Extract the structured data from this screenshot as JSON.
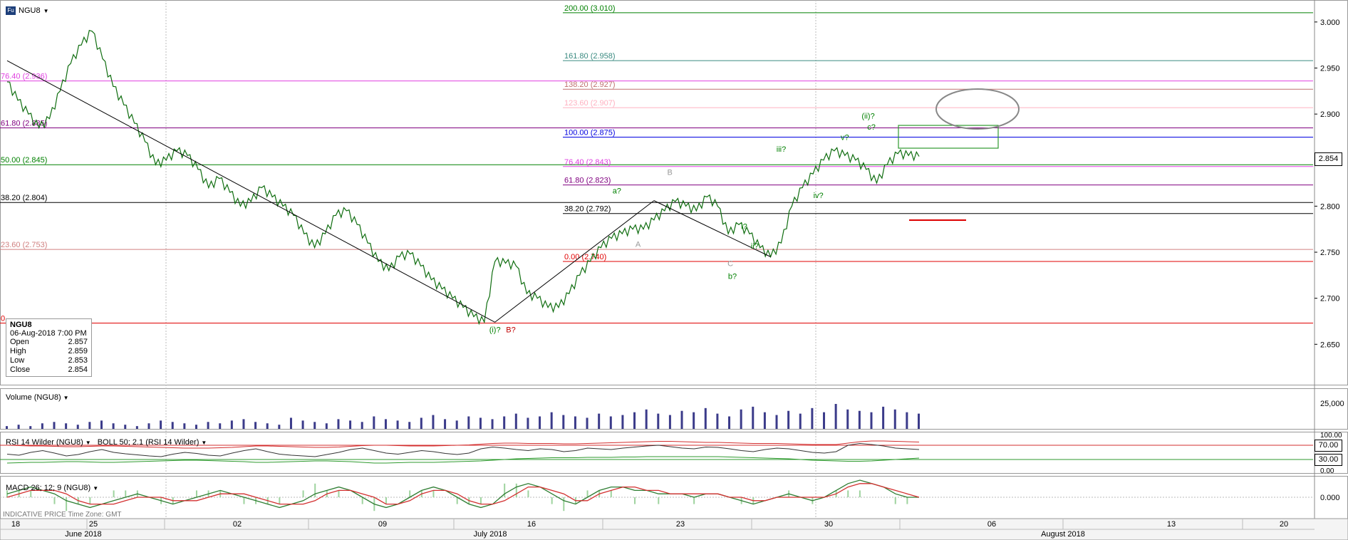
{
  "symbol": "NGU8",
  "chart_data": [
    {
      "type": "line",
      "title": "NGU8",
      "y_ticks": [
        "3.000",
        "2.950",
        "2.900",
        "2.850",
        "2.800",
        "2.750",
        "2.700",
        "2.650"
      ],
      "x_ticks": [
        "18",
        "25",
        "02",
        "09",
        "16",
        "23",
        "30",
        "06",
        "13",
        "20"
      ],
      "month_labels": [
        "June 2018",
        "July 2018",
        "August 2018"
      ],
      "ylim": [
        2.61,
        3.02
      ],
      "last_price": "2.854",
      "price_series": [
        {
          "name": "",
          "values": [
            2.935,
            2.915,
            2.9,
            2.885,
            2.895,
            2.925,
            2.955,
            2.975,
            2.99,
            2.96,
            2.93,
            2.91,
            2.89,
            2.87,
            2.845,
            2.85,
            2.86,
            2.855,
            2.84,
            2.82,
            2.83,
            2.815,
            2.8,
            2.805,
            2.82,
            2.81,
            2.8,
            2.79,
            2.77,
            2.755,
            2.77,
            2.79,
            2.795,
            2.78,
            2.76,
            2.74,
            2.73,
            2.745,
            2.748,
            2.735,
            2.72,
            2.71,
            2.7,
            2.69,
            2.68,
            2.674,
            2.74,
            2.738,
            2.735,
            2.705,
            2.7,
            2.69,
            2.69,
            2.705,
            2.725,
            2.74,
            2.755,
            2.765,
            2.77,
            2.775,
            2.775,
            2.785,
            2.795,
            2.805,
            2.8,
            2.795,
            2.81,
            2.8,
            2.77,
            2.78,
            2.77,
            2.755,
            2.745,
            2.76,
            2.8,
            2.82,
            2.835,
            2.85,
            2.86,
            2.855,
            2.85,
            2.84,
            2.825,
            2.845,
            2.857,
            2.855,
            2.854
          ]
        }
      ],
      "trend_lines": [
        {
          "x": [
            0,
            46
          ],
          "y": [
            2.958,
            2.674
          ]
        },
        {
          "x": [
            46,
            61
          ],
          "y": [
            2.674,
            2.806
          ]
        },
        {
          "x": [
            61,
            72
          ],
          "y": [
            2.806,
            2.745
          ]
        }
      ],
      "fib_left": [
        {
          "label": "76.40 (2.936)",
          "value": 2.936,
          "color": "#e040e0"
        },
        {
          "label": "61.80 (2.885)",
          "value": 2.885,
          "color": "#800080"
        },
        {
          "label": "50.00 (2.845)",
          "value": 2.845,
          "color": "#008000"
        },
        {
          "label": "38.20 (2.804)",
          "value": 2.804,
          "color": "#000000"
        },
        {
          "label": "23.60 (2.753)",
          "value": 2.753,
          "color": "#d08080"
        },
        {
          "label": "0.",
          "value": 2.673,
          "color": "#e00000"
        }
      ],
      "fib_right": [
        {
          "label": "200.00 (3.010)",
          "value": 3.01,
          "color": "#008000"
        },
        {
          "label": "161.80 (2.958)",
          "value": 2.958,
          "color": "#3a8a80"
        },
        {
          "label": "138.20 (2.927)",
          "value": 2.927,
          "color": "#c07070"
        },
        {
          "label": "123.60 (2.907)",
          "value": 2.907,
          "color": "#ffb0c0"
        },
        {
          "label": "100.00 (2.875)",
          "value": 2.875,
          "color": "#0000e0"
        },
        {
          "label": "76.40 (2.843)",
          "value": 2.843,
          "color": "#e040e0"
        },
        {
          "label": "61.80 (2.823)",
          "value": 2.823,
          "color": "#800080"
        },
        {
          "label": "38.20 (2.792)",
          "value": 2.792,
          "color": "#000000"
        },
        {
          "label": "0.00 (2.740)",
          "value": 2.74,
          "color": "#e00000"
        }
      ],
      "wave_labels": [
        {
          "text": "(i)?",
          "x": 46,
          "value": 2.663,
          "color": "#008000"
        },
        {
          "text": "B?",
          "x": 47.5,
          "value": 2.663,
          "color": "#c00000"
        },
        {
          "text": "a?",
          "x": 57.5,
          "value": 2.814,
          "color": "#008000"
        },
        {
          "text": "A",
          "x": 59.5,
          "value": 2.756,
          "color": "#999999"
        },
        {
          "text": "B",
          "x": 62.5,
          "value": 2.834,
          "color": "#999999"
        },
        {
          "text": "C",
          "x": 68.2,
          "value": 2.735,
          "color": "#999999"
        },
        {
          "text": "b?",
          "x": 68.4,
          "value": 2.721,
          "color": "#008000"
        },
        {
          "text": "i?",
          "x": 69.5,
          "value": 2.775,
          "color": "#008000"
        },
        {
          "text": "ii?",
          "x": 70.5,
          "value": 2.754,
          "color": "#008000"
        },
        {
          "text": "iii?",
          "x": 73,
          "value": 2.859,
          "color": "#008000"
        },
        {
          "text": "iv?",
          "x": 76.5,
          "value": 2.809,
          "color": "#008000"
        },
        {
          "text": "v?",
          "x": 79,
          "value": 2.872,
          "color": "#008000"
        },
        {
          "text": "c?",
          "x": 81.5,
          "value": 2.883,
          "color": "#008000"
        },
        {
          "text": "(ii)?",
          "x": 81.2,
          "value": 2.895,
          "color": "#008000"
        }
      ],
      "ohlc": {
        "date": "06-Aug-2018 7:00 PM",
        "open": "2.857",
        "high": "2.859",
        "low": "2.853",
        "close": "2.854"
      },
      "ohlc_labels": {
        "open": "Open",
        "high": "High",
        "low": "Low",
        "close": "Close"
      },
      "footnote": "INDICATIVE PRICE   Time Zone: GMT"
    },
    {
      "type": "bar",
      "title": "Volume (NGU8)",
      "y_ticks": [
        "25,000"
      ],
      "values": [
        2,
        3,
        2,
        4,
        5,
        4,
        3,
        5,
        6,
        4,
        3,
        2,
        4,
        6,
        5,
        4,
        3,
        5,
        4,
        6,
        7,
        5,
        4,
        3,
        8,
        6,
        5,
        4,
        7,
        6,
        5,
        9,
        7,
        6,
        5,
        8,
        10,
        7,
        6,
        9,
        8,
        7,
        9,
        11,
        8,
        9,
        12,
        10,
        9,
        8,
        11,
        9,
        10,
        12,
        14,
        11,
        10,
        13,
        12,
        15,
        11,
        9,
        14,
        16,
        12,
        10,
        13,
        11,
        15,
        12,
        18,
        14,
        13,
        12,
        16,
        14,
        12,
        11
      ]
    },
    {
      "type": "line",
      "title": "RSI 14 Wilder (NGU8)",
      "overlay_title": "BOLL 50; 2.1 (RSI 14 Wilder)",
      "y_ticks": [
        "100.00",
        "70.00",
        "30.00",
        "0.00"
      ],
      "ylim": [
        0,
        100
      ],
      "series": [
        {
          "name": "RSI",
          "values": [
            45,
            42,
            50,
            55,
            48,
            40,
            44,
            52,
            58,
            50,
            46,
            43,
            40,
            38,
            45,
            50,
            47,
            42,
            40,
            48,
            55,
            60,
            52,
            45,
            42,
            40,
            38,
            44,
            50,
            58,
            62,
            55,
            48,
            45,
            50,
            55,
            52,
            47,
            44,
            48,
            60,
            65,
            62,
            58,
            55,
            60,
            58,
            52,
            55,
            62,
            60,
            58,
            62,
            65,
            68,
            70,
            66,
            62,
            60,
            65,
            64,
            60,
            55,
            52,
            58,
            62,
            60,
            55,
            50,
            48,
            52,
            70,
            75,
            72,
            68,
            62,
            60,
            58
          ]
        },
        {
          "name": "Upper",
          "values": [
            70,
            69,
            68,
            68,
            67,
            66,
            66,
            67,
            68,
            68,
            67,
            66,
            65,
            64,
            63,
            62,
            62,
            62,
            63,
            64,
            66,
            68,
            68,
            67,
            66,
            65,
            64,
            64,
            65,
            67,
            69,
            70,
            70,
            69,
            68,
            68,
            68,
            69,
            70,
            71,
            73,
            75,
            76,
            76,
            75,
            75,
            75,
            74,
            74,
            75,
            76,
            77,
            78,
            79,
            80,
            81,
            81,
            80,
            79,
            78,
            78,
            77,
            76,
            75,
            75,
            75,
            74,
            73,
            72,
            72,
            72,
            76,
            80,
            82,
            82,
            81,
            80,
            79
          ]
        },
        {
          "name": "Lower",
          "values": [
            20,
            21,
            22,
            22,
            23,
            24,
            24,
            23,
            22,
            22,
            23,
            24,
            25,
            26,
            27,
            28,
            28,
            27,
            26,
            25,
            24,
            22,
            22,
            23,
            24,
            25,
            26,
            26,
            25,
            24,
            22,
            20,
            20,
            21,
            22,
            22,
            22,
            23,
            24,
            25,
            26,
            28,
            30,
            32,
            33,
            34,
            35,
            35,
            35,
            36,
            36,
            36,
            37,
            37,
            38,
            38,
            38,
            38,
            38,
            38,
            38,
            37,
            36,
            35,
            34,
            33,
            32,
            30,
            28,
            27,
            26,
            25,
            25,
            26,
            28,
            30,
            32,
            34
          ]
        }
      ]
    },
    {
      "type": "line",
      "title": "MACD 26; 12; 9 (NGU8)",
      "y_ticks": [
        "0.000"
      ],
      "ylim": [
        -0.05,
        0.05
      ],
      "series": [
        {
          "name": "MACD",
          "values": [
            0.01,
            0.02,
            0.03,
            0.02,
            0.01,
            -0.01,
            -0.02,
            -0.03,
            -0.02,
            -0.01,
            0.0,
            0.01,
            0.0,
            -0.01,
            -0.02,
            -0.01,
            0.0,
            0.01,
            0.02,
            0.01,
            0.0,
            -0.01,
            -0.02,
            -0.03,
            -0.02,
            -0.01,
            0.01,
            0.02,
            0.03,
            0.02,
            0.0,
            -0.02,
            -0.03,
            -0.02,
            0.0,
            0.02,
            0.03,
            0.02,
            0.0,
            -0.02,
            -0.03,
            -0.02,
            0.01,
            0.03,
            0.04,
            0.03,
            0.01,
            -0.01,
            -0.02,
            0.0,
            0.02,
            0.03,
            0.03,
            0.02,
            0.02,
            0.01,
            0.01,
            0.01,
            0.0,
            0.01,
            0.01,
            0.0,
            -0.01,
            -0.02,
            -0.01,
            0.0,
            0.01,
            0.0,
            -0.01,
            0.0,
            0.02,
            0.04,
            0.05,
            0.04,
            0.03,
            0.01,
            0.0,
            0.0
          ]
        },
        {
          "name": "Signal",
          "values": [
            0.0,
            0.01,
            0.02,
            0.02,
            0.02,
            0.01,
            -0.01,
            -0.02,
            -0.02,
            -0.02,
            -0.01,
            0.0,
            0.0,
            0.0,
            -0.01,
            -0.01,
            -0.01,
            0.0,
            0.01,
            0.01,
            0.01,
            0.0,
            -0.01,
            -0.02,
            -0.02,
            -0.02,
            -0.01,
            0.01,
            0.02,
            0.02,
            0.01,
            0.0,
            -0.02,
            -0.02,
            -0.01,
            0.01,
            0.02,
            0.02,
            0.01,
            -0.01,
            -0.02,
            -0.02,
            -0.01,
            0.01,
            0.03,
            0.03,
            0.02,
            0.01,
            -0.01,
            -0.01,
            0.01,
            0.02,
            0.03,
            0.03,
            0.02,
            0.02,
            0.01,
            0.01,
            0.01,
            0.01,
            0.01,
            0.0,
            0.0,
            -0.01,
            -0.01,
            0.0,
            0.0,
            0.0,
            0.0,
            0.0,
            0.01,
            0.03,
            0.04,
            0.04,
            0.03,
            0.02,
            0.01,
            0.0
          ]
        }
      ]
    }
  ],
  "colors": {
    "macd": "#2e7d32",
    "signal": "#d32f2f",
    "volume": "#3b3b8a",
    "price": "#0f6d0f",
    "rsi": "#333333",
    "boll_upper": "#d32f2f",
    "boll_lower": "#2e9a2e"
  }
}
